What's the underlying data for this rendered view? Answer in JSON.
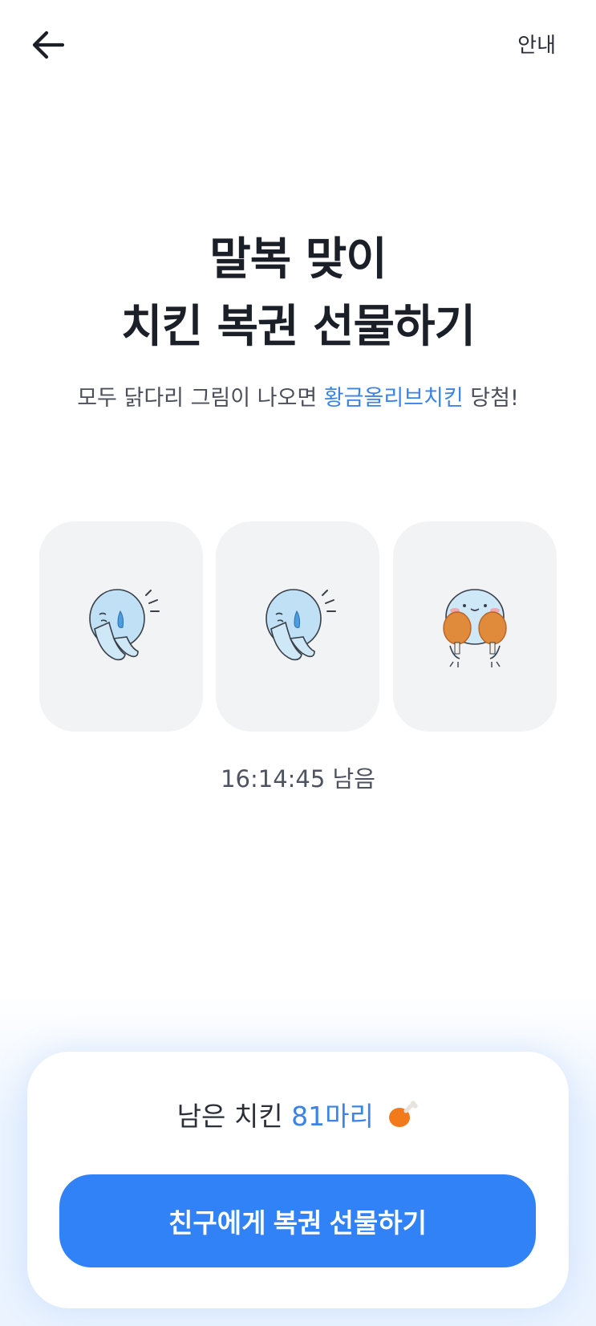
{
  "header": {
    "back_icon": "arrow-left-icon",
    "info_label": "안내"
  },
  "title": {
    "line1": "말복 맞이",
    "line2": "치킨 복권 선물하기"
  },
  "subtitle": {
    "prefix": "모두 닭다리 그림이 나오면 ",
    "highlight": "황금올리브치킨",
    "suffix": " 당첨!",
    "highlight_color": "#3a84e8"
  },
  "slots": [
    {
      "character": "sweating-praying-character"
    },
    {
      "character": "sweating-praying-character"
    },
    {
      "character": "character-holding-drumsticks"
    }
  ],
  "timer": {
    "text": "16:14:45 남음"
  },
  "bottom_card": {
    "remaining_prefix": "남은 치킨 ",
    "remaining_count": "81마리",
    "remaining_icon": "drumstick-icon",
    "button_label": "친구에게 복권 선물하기",
    "button_color": "#3182f6"
  }
}
